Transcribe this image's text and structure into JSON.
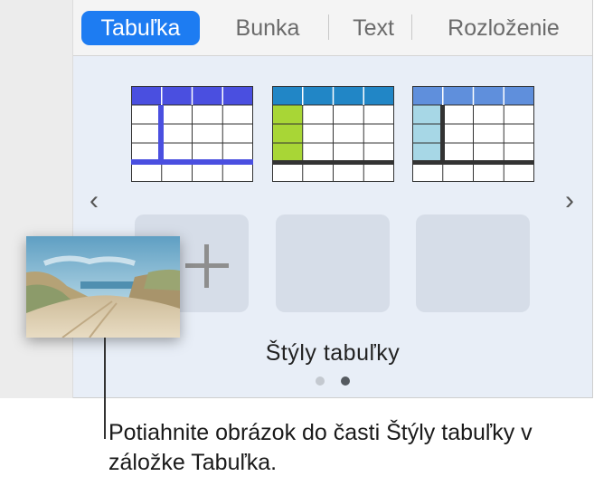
{
  "tabs": [
    {
      "label": "Tabuľka",
      "active": true
    },
    {
      "label": "Bunka",
      "active": false
    },
    {
      "label": "Text",
      "active": false
    },
    {
      "label": "Rozloženie",
      "active": false
    }
  ],
  "table_styles": [
    {
      "header_color": "#4a4fe0",
      "accent_color": "#4a4fe0"
    },
    {
      "header_color": "#2186c6",
      "accent_color": "#a8d636"
    },
    {
      "header_color": "#5f8fdc",
      "accent_color": "#a7d7e6"
    }
  ],
  "nav": {
    "prev_icon": "chevron-left-icon",
    "next_icon": "chevron-right-icon",
    "prev_glyph": "‹",
    "next_glyph": "›"
  },
  "panel": {
    "section_label": "Štýly tabuľky",
    "page_count": 2,
    "current_page": 2
  },
  "callout": {
    "text": "Potiahnite obrázok do časti Štýly tabuľky v záložke Tabuľka."
  },
  "colors": {
    "accent": "#1d7cf2",
    "panel_bg": "#e8eef7"
  }
}
